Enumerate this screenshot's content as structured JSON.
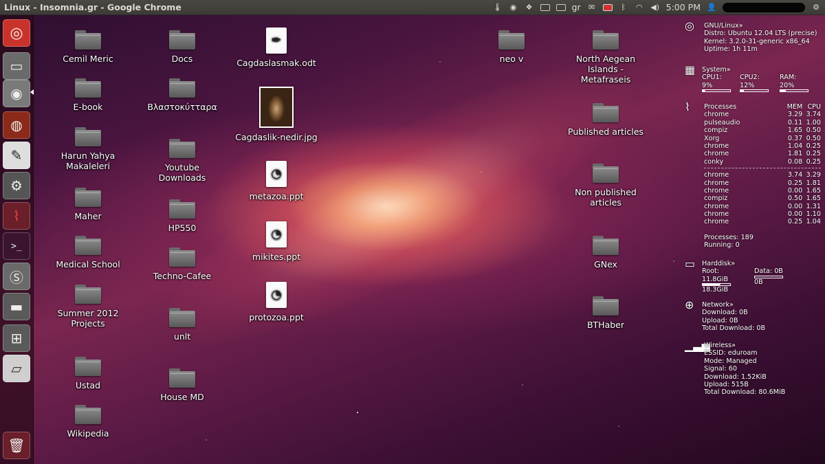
{
  "top_panel": {
    "window_title": "Linux - Insomnia.gr - Google Chrome",
    "keyboard_layout": "gr",
    "time": "5:00 PM",
    "icons": [
      "thermometer-icon",
      "network-manager-icon",
      "dropbox-icon",
      "drive-icon",
      "keyboard-icon",
      "mail-icon",
      "battery-icon",
      "bluetooth-icon",
      "wifi-icon",
      "volume-icon",
      "user-icon",
      "gear-icon"
    ]
  },
  "launcher": {
    "items": [
      {
        "name": "dash-home",
        "icon": "ubuntu-logo-icon"
      },
      {
        "name": "files",
        "icon": "folder-icon"
      },
      {
        "name": "chrome",
        "icon": "chrome-icon",
        "active": true
      },
      {
        "name": "firefox",
        "icon": "firefox-icon"
      },
      {
        "name": "text-editor",
        "icon": "pen-icon"
      },
      {
        "name": "settings",
        "icon": "gear-icon"
      },
      {
        "name": "system-monitor",
        "icon": "pulse-icon"
      },
      {
        "name": "terminal",
        "icon": "terminal-icon"
      },
      {
        "name": "skype",
        "icon": "skype-icon"
      },
      {
        "name": "disk",
        "icon": "disk-icon"
      },
      {
        "name": "workspaces",
        "icon": "workspaces-icon"
      },
      {
        "name": "drive",
        "icon": "drive-icon"
      },
      {
        "name": "trash",
        "icon": "trash-icon"
      }
    ]
  },
  "desktop": {
    "col1": [
      "Cemil Meric",
      "E-book",
      "Harun Yahya Makaleleri",
      "Maher",
      "Medical School",
      "Summer 2012 Projects",
      "Ustad",
      "Wikipedia"
    ],
    "col2": [
      "Docs",
      "Βλαστοκύτταρα",
      "Youtube Downloads",
      "HP550",
      "Techno-Cafee",
      "unlt",
      "House MD"
    ],
    "col3": [
      "Cagdaslasmak.odt",
      "Cagdaslik-nedir.jpg",
      "metazoa.ppt",
      "mikites.ppt",
      "protozoa.ppt"
    ],
    "col4": [
      "neo v"
    ],
    "col5": [
      "North Aegean Islands - Metafraseis",
      "Published articles",
      "Non published articles",
      "GNex",
      "BTHaber"
    ]
  },
  "conky": {
    "os": {
      "title": "GNU/Linux»",
      "distro": "Distro: Ubuntu 12.04 LTS (precise)",
      "kernel": "Kernel: 3.2.0-31-generic x86_64",
      "uptime": "Uptime: 1h 11m"
    },
    "system": {
      "title": "System»",
      "cpu1": "CPU1: 9%",
      "cpu2": "CPU2: 12%",
      "ram": "RAM: 20%",
      "cpu1_level": 0.09,
      "cpu2_level": 0.12,
      "ram_level": 0.2
    },
    "processes": {
      "title": "Processes",
      "mem_header": "MEM",
      "cpu_header": "CPU",
      "by_mem": [
        [
          "chrome",
          "3.29",
          "3.74"
        ],
        [
          "pulseaudio",
          "0.11",
          "1.00"
        ],
        [
          "compiz",
          "1.65",
          "0.50"
        ],
        [
          "Xorg",
          "0.37",
          "0.50"
        ],
        [
          "chrome",
          "1.04",
          "0.25"
        ],
        [
          "chrome",
          "1.81",
          "0.25"
        ],
        [
          "conky",
          "0.08",
          "0.25"
        ]
      ],
      "by_cpu": [
        [
          "chrome",
          "3.74",
          "3.29"
        ],
        [
          "chrome",
          "0.25",
          "1.81"
        ],
        [
          "chrome",
          "0.00",
          "1.65"
        ],
        [
          "compiz",
          "0.50",
          "1.65"
        ],
        [
          "chrome",
          "0.00",
          "1.31"
        ],
        [
          "chrome",
          "0.00",
          "1.10"
        ],
        [
          "chrome",
          "0.25",
          "1.04"
        ]
      ],
      "total": "Processes: 189",
      "running": "Running: 0"
    },
    "harddisk": {
      "title": "Harddisk»",
      "root": "Root: 11.8GiB",
      "data": "Data: 0B",
      "root_total": "18.3GiB",
      "data_total": "0B",
      "root_level": 0.64,
      "data_level": 0.0
    },
    "network": {
      "title": "Network»",
      "download": "Download: 0B",
      "upload": "Upload: 0B",
      "total": "Total Download: 0B"
    },
    "wireless": {
      "title": "Wireless»",
      "essid": "ESSID: eduroam",
      "mode": "Mode: Managed",
      "signal": "Signal: 60",
      "download": "Download: 1.52KiB",
      "upload": "Upload: 515B",
      "total": "Total Download: 80.6MiB"
    }
  }
}
